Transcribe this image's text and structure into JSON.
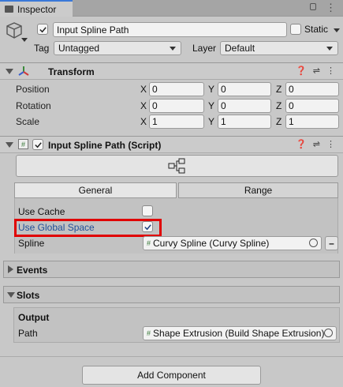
{
  "tab": {
    "title": "Inspector"
  },
  "object": {
    "name": "Input Spline Path",
    "static_label": "Static",
    "tag_label": "Tag",
    "tag_value": "Untagged",
    "layer_label": "Layer",
    "layer_value": "Default"
  },
  "transform": {
    "title": "Transform",
    "rows": [
      {
        "label": "Position",
        "x": "0",
        "y": "0",
        "z": "0"
      },
      {
        "label": "Rotation",
        "x": "0",
        "y": "0",
        "z": "0"
      },
      {
        "label": "Scale",
        "x": "1",
        "y": "1",
        "z": "1"
      }
    ],
    "axis": {
      "x": "X",
      "y": "Y",
      "z": "Z"
    }
  },
  "script": {
    "title": "Input Spline Path (Script)",
    "tabs": [
      "General",
      "Range"
    ],
    "use_cache": "Use Cache",
    "use_global_space": "Use Global Space",
    "spline_label": "Spline",
    "spline_value": "Curvy Spline (Curvy Spline)",
    "minus": "–"
  },
  "events": {
    "title": "Events"
  },
  "slots": {
    "title": "Slots",
    "output": "Output",
    "path_label": "Path",
    "path_value": "Shape Extrusion (Build Shape Extrusion)"
  },
  "add_component": "Add Component",
  "colors": {
    "highlight": "#e00000",
    "accent": "#3a78d8",
    "link_label": "#1f4f99"
  }
}
